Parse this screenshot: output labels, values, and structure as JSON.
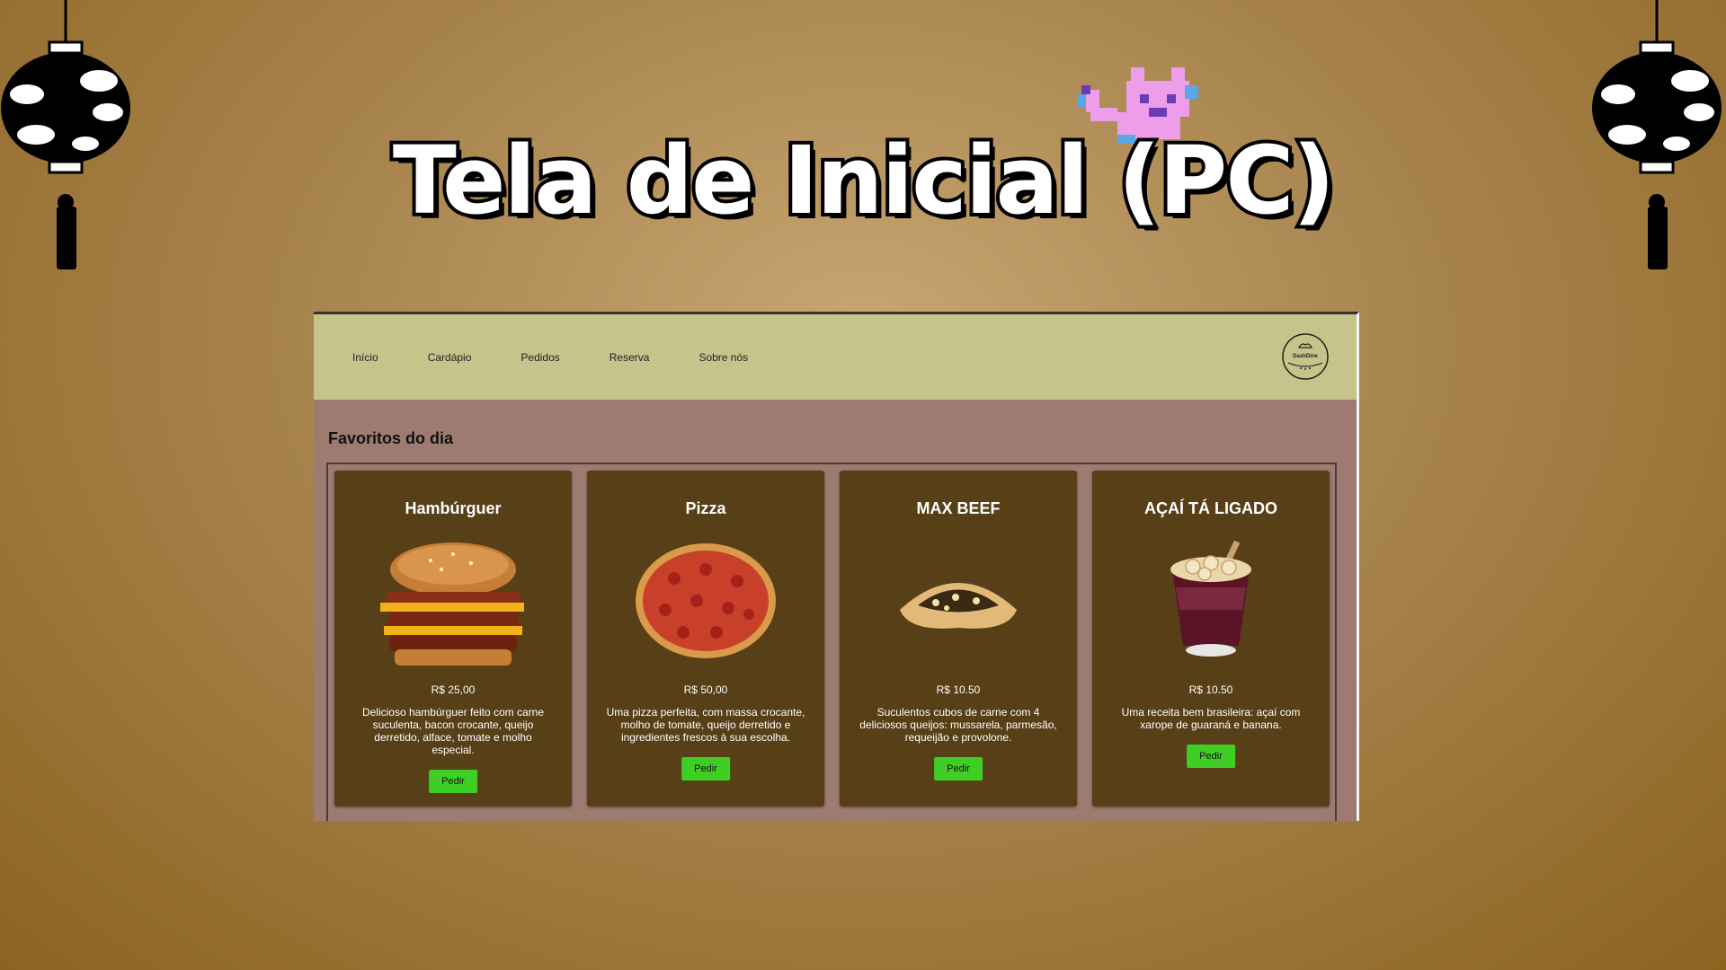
{
  "slide": {
    "title": "Tela de Inicial (PC)"
  },
  "nav": {
    "items": [
      {
        "label": "Início"
      },
      {
        "label": "Cardápio"
      },
      {
        "label": "Pedidos"
      },
      {
        "label": "Reserva"
      },
      {
        "label": "Sobre nós"
      }
    ],
    "logo_text": "DashDine"
  },
  "section": {
    "title": "Favoritos do dia"
  },
  "cards": [
    {
      "name": "Hambúrguer",
      "price": "R$ 25,00",
      "description": "Delicioso hambúrguer feito com carne suculenta, bacon crocante, queijo derretido, alface, tomate e molho especial.",
      "button": "Pedir"
    },
    {
      "name": "Pizza",
      "price": "R$ 50,00",
      "description": "Uma pizza perfeita, com massa crocante, molho de tomate, queijo derretido e ingredientes frescos à sua escolha.",
      "button": "Pedir"
    },
    {
      "name": "MAX BEEF",
      "price": "R$ 10.50",
      "description": "Suculentos cubos de carne com 4 deliciosos queijos: mussarela, parmesão, requeijão e provolone.",
      "button": "Pedir"
    },
    {
      "name": "AÇAÍ TÁ LIGADO",
      "price": "R$ 10.50",
      "description": "Uma receita bem brasileira: açaí com xarope de guaraná e banana.",
      "button": "Pedir"
    }
  ]
}
